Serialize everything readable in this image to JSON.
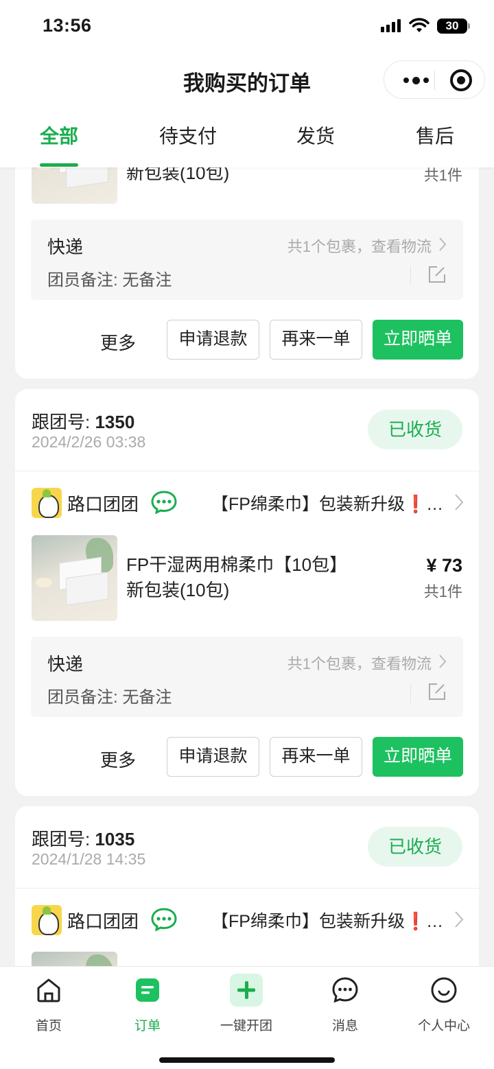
{
  "status_bar": {
    "time": "13:56",
    "battery": "30"
  },
  "nav": {
    "title": "我购买的订单"
  },
  "tabs": [
    {
      "label": "全部",
      "active": true
    },
    {
      "label": "待支付",
      "active": false
    },
    {
      "label": "发货",
      "active": false
    },
    {
      "label": "售后",
      "active": false
    }
  ],
  "top_card": {
    "product_variant": "新包装(10包)",
    "qty": "共1件",
    "delivery": "快递",
    "logistics": "共1个包裹，查看物流",
    "note": "团员备注: 无备注",
    "more": "更多",
    "buttons": {
      "refund": "申请退款",
      "reorder": "再来一单",
      "review": "立即晒单"
    }
  },
  "orders": [
    {
      "no_label": "跟团号: ",
      "no": "1350",
      "time": "2024/2/26 03:38",
      "status": "已收货",
      "shop": "路口团团",
      "shop_desc": "【FP绵柔巾】包装新升级❗️品牌正品",
      "product_name": "FP干湿两用棉柔巾【10包】",
      "product_variant": "新包装(10包)",
      "price": "¥ 73",
      "qty": "共1件",
      "delivery": "快递",
      "logistics": "共1个包裹，查看物流",
      "note": "团员备注: 无备注",
      "more": "更多",
      "buttons": {
        "refund": "申请退款",
        "reorder": "再来一单",
        "review": "立即晒单"
      }
    },
    {
      "no_label": "跟团号: ",
      "no": "1035",
      "time": "2024/1/28 14:35",
      "status": "已收货",
      "shop": "路口团团",
      "shop_desc": "【FP绵柔巾】包装新升级❗️品牌正品"
    }
  ],
  "tabbar": [
    {
      "label": "首页",
      "icon": "home-icon",
      "active": false
    },
    {
      "label": "订单",
      "icon": "order-icon",
      "active": true
    },
    {
      "label": "一键开团",
      "icon": "plus-icon",
      "active": false
    },
    {
      "label": "消息",
      "icon": "message-icon",
      "active": false
    },
    {
      "label": "个人中心",
      "icon": "profile-icon",
      "active": false
    }
  ],
  "colors": {
    "accent": "#1aad4e",
    "primary_button": "#1dc160",
    "pill_bg": "#e8f7ee",
    "page_bg": "#f2f2f2"
  }
}
